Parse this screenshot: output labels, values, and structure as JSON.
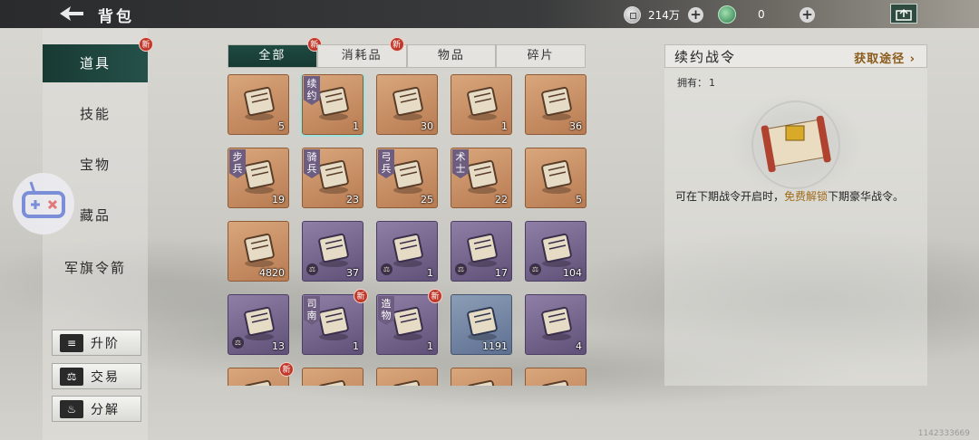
{
  "header": {
    "title": "背包",
    "silver": {
      "icon": "silver-coin-icon",
      "value": "214万"
    },
    "jade": {
      "icon": "jade-icon",
      "value": "0"
    }
  },
  "nav": [
    {
      "label": "道具",
      "active": true,
      "badge": "新"
    },
    {
      "label": "技能",
      "active": false
    },
    {
      "label": "宝物",
      "active": false
    },
    {
      "label": "藏品",
      "active": false
    },
    {
      "label": "军旗令箭",
      "active": false
    }
  ],
  "actions": [
    {
      "label": "升阶",
      "icon": "upgrade-icon"
    },
    {
      "label": "交易",
      "icon": "scale-icon"
    },
    {
      "label": "分解",
      "icon": "cauldron-icon"
    }
  ],
  "tabs": [
    {
      "label": "全部",
      "active": true,
      "badge": "新"
    },
    {
      "label": "消耗品",
      "active": false,
      "badge": "新"
    },
    {
      "label": "物品",
      "active": false
    },
    {
      "label": "碎片",
      "active": false
    }
  ],
  "items": [
    {
      "name": "tome",
      "color": "orange",
      "count": "5",
      "tag": ""
    },
    {
      "name": "contract-scroll",
      "color": "orange",
      "count": "1",
      "tag": "续约",
      "selected": true
    },
    {
      "name": "armor",
      "color": "orange",
      "count": "30",
      "tag": ""
    },
    {
      "name": "letter-scroll",
      "color": "orange",
      "count": "1",
      "tag": ""
    },
    {
      "name": "red-envelope",
      "color": "orange",
      "count": "36",
      "tag": ""
    },
    {
      "name": "book",
      "color": "orange",
      "count": "19",
      "tag": "步兵"
    },
    {
      "name": "book",
      "color": "orange",
      "count": "23",
      "tag": "骑兵"
    },
    {
      "name": "book",
      "color": "orange",
      "count": "25",
      "tag": "弓兵"
    },
    {
      "name": "book",
      "color": "orange",
      "count": "22",
      "tag": "术士"
    },
    {
      "name": "rolled-scroll",
      "color": "orange",
      "count": "5",
      "tag": ""
    },
    {
      "name": "bamboo-slips",
      "color": "orange",
      "count": "4820",
      "tag": ""
    },
    {
      "name": "warrior-figure",
      "color": "purple",
      "count": "37",
      "tag": "",
      "trade": true
    },
    {
      "name": "warrior-figure",
      "color": "purple",
      "count": "1",
      "tag": "",
      "trade": true
    },
    {
      "name": "drum",
      "color": "purple",
      "count": "17",
      "tag": "",
      "trade": true
    },
    {
      "name": "gold-pile",
      "color": "purple",
      "count": "104",
      "tag": "",
      "trade": true
    },
    {
      "name": "seal-token",
      "color": "purple",
      "count": "13",
      "tag": "",
      "trade": true
    },
    {
      "name": "compass-box",
      "color": "purple",
      "count": "1",
      "tag": "司南",
      "badge": "新"
    },
    {
      "name": "craft-chest",
      "color": "purple",
      "count": "1",
      "tag": "造物",
      "badge": "新"
    },
    {
      "name": "supplies",
      "color": "blue",
      "count": "1191",
      "tag": ""
    },
    {
      "name": "decree-scroll",
      "color": "purple",
      "count": "4",
      "tag": ""
    },
    {
      "name": "item",
      "color": "orange",
      "count": "",
      "tag": "",
      "badge": "新"
    },
    {
      "name": "item",
      "color": "orange",
      "count": "",
      "tag": ""
    },
    {
      "name": "item",
      "color": "orange",
      "count": "",
      "tag": ""
    },
    {
      "name": "item",
      "color": "orange",
      "count": "",
      "tag": ""
    },
    {
      "name": "item",
      "color": "orange",
      "count": "",
      "tag": ""
    }
  ],
  "detail": {
    "title": "续约战令",
    "link": "获取途径",
    "own_label": "拥有：",
    "own_value": "1",
    "desc_pre": "可在下期战令开启时，",
    "desc_hl": "免费解锁",
    "desc_post": "下期豪华战令。"
  },
  "footer": {
    "uid": "1142333669"
  },
  "colors": {
    "accent": "#173a33",
    "orange_rarity": "#c98e62",
    "purple_rarity": "#7a6b92",
    "blue_rarity": "#71829f",
    "highlight": "#a06a1a"
  }
}
